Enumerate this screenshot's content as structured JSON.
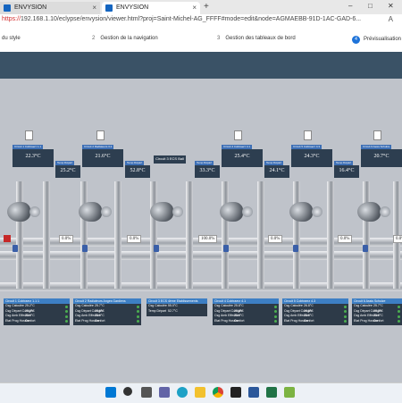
{
  "browser": {
    "tabs": [
      {
        "label": "ENVYSION",
        "close": "×"
      },
      {
        "label": "ENVYSION",
        "close": "×"
      }
    ],
    "new_tab": "+",
    "window_controls": {
      "minimize": "–",
      "maximize": "□",
      "close": "✕"
    },
    "url_scheme": "https://",
    "url_rest": "192.168.1.10/eclypse/envysion/viewer.html?proj=Saint-Michel-AG_FFFF#mode=edit&node=AGMAEBB-91D-1AC-GAD-6...",
    "reader_icon": "A"
  },
  "steps": [
    {
      "num": "",
      "label": "du style"
    },
    {
      "num": "2",
      "label": "Gestion de la navigation"
    },
    {
      "num": "3",
      "label": "Gestion des tableaux de bord"
    },
    {
      "num": "4",
      "label": "Prévisualisation"
    }
  ],
  "widgets": [
    {
      "title": "Circuit 1 Cobtraerz 1.1",
      "value": "22.3°C"
    },
    {
      "title": "Circuit 2 Radiateurs 3.2",
      "value": "21.6°C"
    },
    {
      "title": "Temp Départ",
      "value": "25.2°C"
    },
    {
      "title": "Temp Départ",
      "value": "52.8°C"
    },
    {
      "title": "Circuit 3 ECS Ball",
      "value": ""
    },
    {
      "title": "Temp Départ",
      "value": "33.3°C"
    },
    {
      "title": "Circuit 4 Cobtraerz 4.1",
      "value": "25.4°C"
    },
    {
      "title": "Temp Départ",
      "value": "24.1°C"
    },
    {
      "title": "Circuit 5 Cobtraerz 4.3",
      "value": "24.3°C"
    },
    {
      "title": "Temp Départ",
      "value": "16.4°C"
    },
    {
      "title": "Circuit 6 Assis Schulze",
      "value": "20.7°C"
    }
  ],
  "flows": [
    "0.0%",
    "0.0%",
    "100.0%",
    "0.0%",
    "0.0%",
    "0.0%"
  ],
  "panels": [
    {
      "title": "Circuit 1 Cobtraerz 1.1 1",
      "rows": [
        {
          "label": "Csg Calculée",
          "value": "25.2°C"
        },
        {
          "label": "Csg Départ Corrigée",
          "value": "25.2°C"
        },
        {
          "label": "Csg Amb Effective",
          "value": "20.0°C"
        },
        {
          "label": "Etat Prog Horaire",
          "value": "Confort"
        }
      ]
    },
    {
      "title": "Circuit 2 Radiateurs Anges Gardiens",
      "rows": [
        {
          "label": "Csg Calculée",
          "value": "25.7°C"
        },
        {
          "label": "Csg Départ Corrigée",
          "value": "25.0°C"
        },
        {
          "label": "Csg Amb Effective",
          "value": "20.0°C"
        },
        {
          "label": "Etat Prog Horaire",
          "value": "Confort"
        }
      ]
    },
    {
      "title": "Circuit 3 ECS 4ème Etablissements",
      "rows": [
        {
          "label": "Csg Calculée",
          "value": "55.0°C"
        },
        {
          "label": "Temp Départ",
          "value": "52.7°C"
        }
      ]
    },
    {
      "title": "Circuit 4 Cobtraerz 4.1",
      "rows": [
        {
          "label": "Csg Calculée",
          "value": "25.8°C"
        },
        {
          "label": "Csg Départ Corrigée",
          "value": "25.8°C"
        },
        {
          "label": "Csg Amb Effective",
          "value": "20.0°C"
        },
        {
          "label": "Etat Prog Horaire",
          "value": "Confort"
        }
      ]
    },
    {
      "title": "Circuit 5 Cobtraerz 4.3",
      "rows": [
        {
          "label": "Csg Calculée",
          "value": "26.8°C"
        },
        {
          "label": "Csg Départ Corrigée",
          "value": "26.8°C"
        },
        {
          "label": "Csg Amb Effective",
          "value": "20.0°C"
        },
        {
          "label": "Etat Prog Horaire",
          "value": "Confort"
        }
      ]
    },
    {
      "title": "Circuit 6 Assis Schulze",
      "rows": [
        {
          "label": "Csg Calculée",
          "value": "25.7°C"
        },
        {
          "label": "Csg Départ Corrigée",
          "value": "25.3°C"
        },
        {
          "label": "Csg Amb Effective",
          "value": "20.0°C"
        },
        {
          "label": "Etat Prog Horaire",
          "value": "Confort"
        }
      ]
    }
  ],
  "taskbar_icons": [
    "windows-icon",
    "search-icon",
    "task-view-icon",
    "teams-icon",
    "edge-icon",
    "file-explorer-icon",
    "chrome-icon",
    "media-icon",
    "word-icon",
    "excel-icon",
    "greenshot-icon"
  ],
  "colors": {
    "nav": "#3a5266",
    "accent": "#1e73d9",
    "panel_header": "#3d7fc4",
    "status_ok": "#4caf50"
  }
}
